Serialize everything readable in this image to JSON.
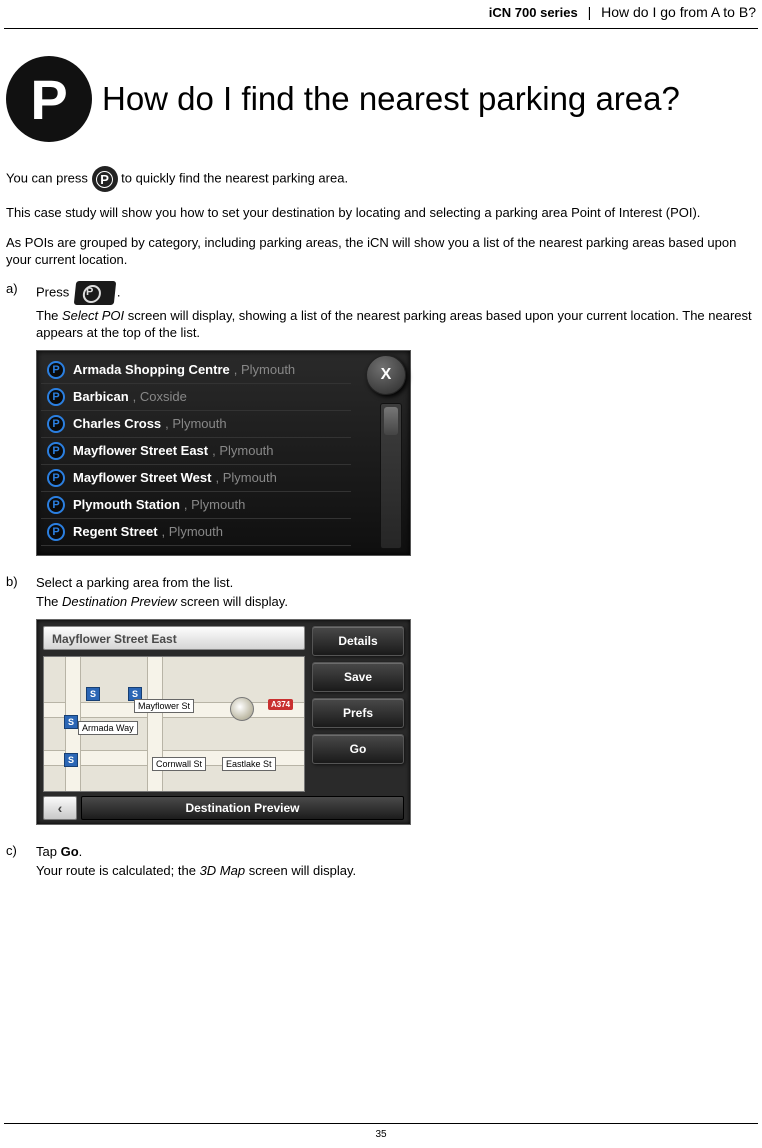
{
  "header": {
    "series": "iCN 700 series",
    "separator": "|",
    "breadcrumb": "How do I go from A to B?"
  },
  "title": "How do I find the nearest parking area?",
  "intro": {
    "p1a": "You can press ",
    "p1b": " to quickly find the nearest parking area.",
    "p2": "This case study will show you how to set your destination by locating and selecting a parking area Point of Interest (POI).",
    "p3": "As POIs are grouped by category, including parking areas, the iCN will show you a list of the nearest parking areas based upon your current location."
  },
  "steps": {
    "a": {
      "marker": "a)",
      "line1a": "Press ",
      "line1b": ".",
      "line2a": "The ",
      "line2i": "Select POI",
      "line2b": " screen will display, showing a list of the nearest parking areas based upon your current location. The nearest appears at the top of the list."
    },
    "b": {
      "marker": "b)",
      "line1": "Select a parking area from the list.",
      "line2a": "The ",
      "line2i": "Destination Preview",
      "line2b": " screen will display."
    },
    "c": {
      "marker": "c)",
      "line1a": "Tap ",
      "line1b": "Go",
      "line1c": ".",
      "line2a": "Your route is calculated; the ",
      "line2i": "3D Map",
      "line2b": " screen will display."
    }
  },
  "poi_list": {
    "close_label": "X",
    "items": [
      {
        "name": "Armada Shopping Centre",
        "sub": ", Plymouth"
      },
      {
        "name": "Barbican",
        "sub": ", Coxside"
      },
      {
        "name": "Charles Cross",
        "sub": ", Plymouth"
      },
      {
        "name": "Mayflower Street East",
        "sub": ", Plymouth"
      },
      {
        "name": "Mayflower Street West",
        "sub": ", Plymouth"
      },
      {
        "name": "Plymouth Station",
        "sub": ", Plymouth"
      },
      {
        "name": "Regent Street",
        "sub": ", Plymouth"
      }
    ]
  },
  "dest_preview": {
    "title": "Mayflower Street East",
    "buttons": [
      "Details",
      "Save",
      "Prefs",
      "Go"
    ],
    "map_labels": {
      "mayflower": "Mayflower St",
      "armada": "Armada Way",
      "cornwall": "Cornwall St",
      "eastlake": "Eastlake St",
      "shield": "A374"
    },
    "back_glyph": "‹",
    "caption": "Destination Preview"
  },
  "page_number": "35"
}
